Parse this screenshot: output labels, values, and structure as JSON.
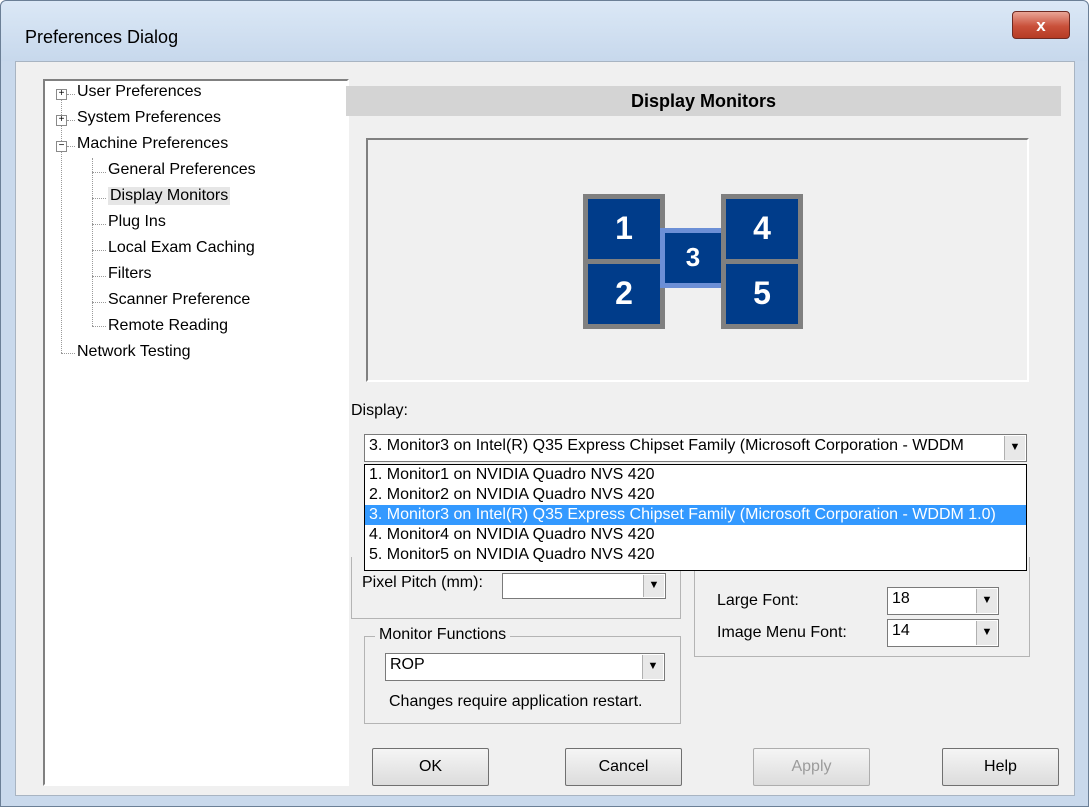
{
  "window": {
    "title": "Preferences Dialog",
    "close_label": "x"
  },
  "tree": {
    "user_preferences": "User Preferences",
    "system_preferences": "System Preferences",
    "machine_preferences": "Machine Preferences",
    "general_preferences": "General Preferences",
    "display_monitors": "Display Monitors",
    "plug_ins": "Plug Ins",
    "local_exam_caching": "Local Exam Caching",
    "filters": "Filters",
    "scanner_preference": "Scanner Preference",
    "remote_reading": "Remote Reading",
    "network_testing": "Network Testing",
    "expand_symbol": "+",
    "collapse_symbol": "−"
  },
  "panel": {
    "header": "Display Monitors",
    "monitors": [
      "1",
      "2",
      "3",
      "4",
      "5"
    ],
    "display_label": "Display:",
    "display_value": "3. Monitor3 on Intel(R) Q35 Express Chipset Family (Microsoft Corporation - WDDM",
    "display_options": [
      "1. Monitor1 on NVIDIA Quadro NVS 420",
      "2. Monitor2 on NVIDIA Quadro NVS 420",
      "3. Monitor3 on Intel(R) Q35 Express Chipset Family (Microsoft Corporation - WDDM 1.0)",
      "4. Monitor4 on NVIDIA Quadro NVS 420",
      "5. Monitor5 on NVIDIA Quadro NVS 420"
    ],
    "pixel_pitch_label": "Pixel Pitch (mm):",
    "pixel_pitch_value": "",
    "large_font_label": "Large Font:",
    "large_font_value": "18",
    "image_menu_font_label": "Image Menu Font:",
    "image_menu_font_value": "14",
    "monitor_functions_label": "Monitor Functions",
    "monitor_functions_value": "ROP",
    "restart_note": "Changes require application restart.",
    "dropdown_arrow": "▼"
  },
  "buttons": {
    "ok": "OK",
    "cancel": "Cancel",
    "apply": "Apply",
    "help": "Help"
  }
}
